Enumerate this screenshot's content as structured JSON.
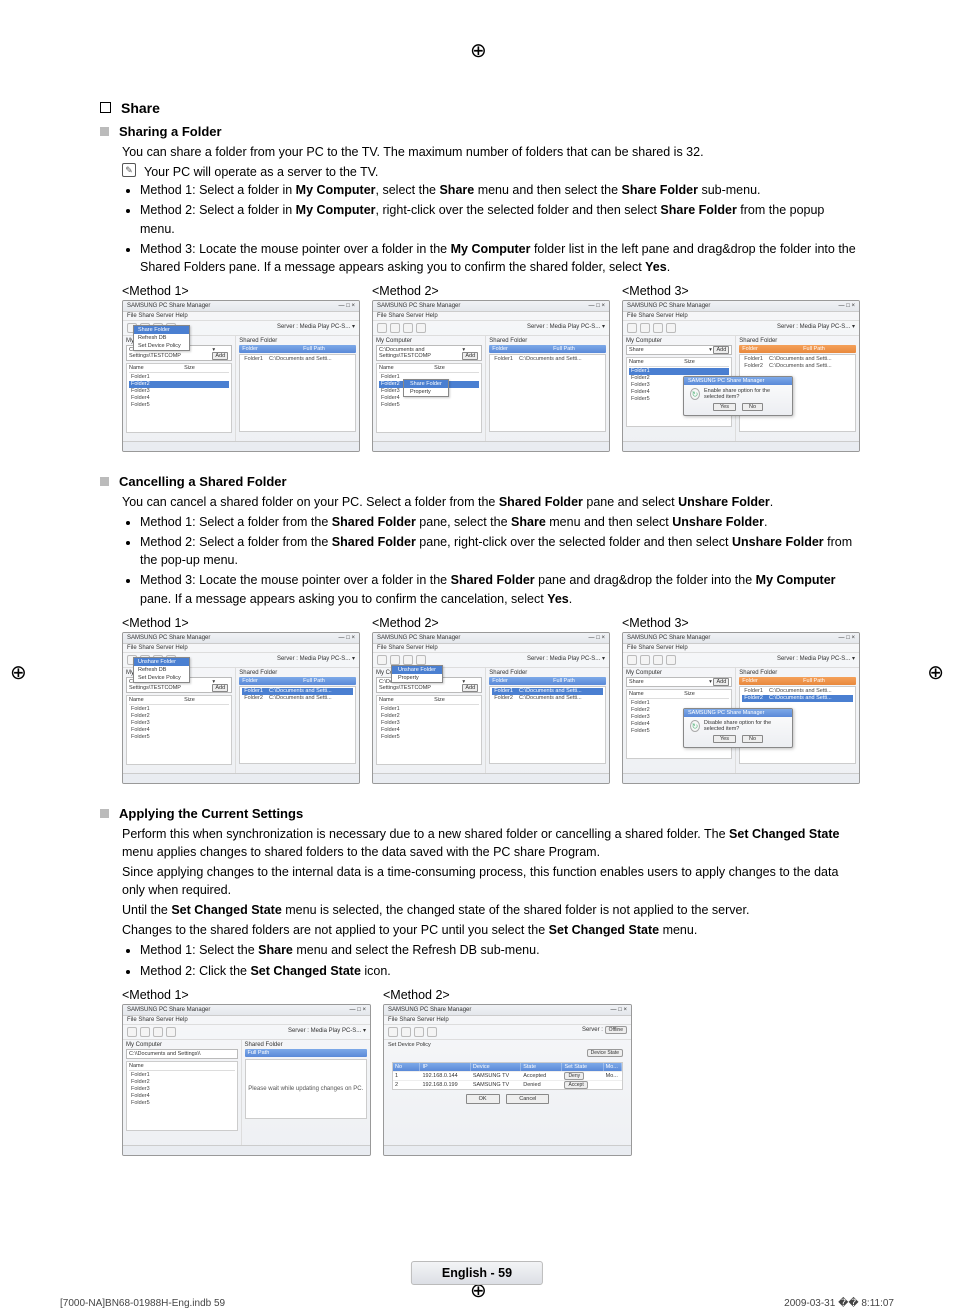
{
  "sectionTitle": "Share",
  "sharing": {
    "title": "Sharing a Folder",
    "intro": "You can share a folder from your PC to the TV. The maximum number of folders that can be shared is 32.",
    "note": "Your PC will operate as a server to the TV.",
    "m1_a": "Method 1: Select a folder in ",
    "m1_b": "My Computer",
    "m1_c": ", select the ",
    "m1_d": "Share",
    "m1_e": " menu and then select the ",
    "m1_f": "Share Folder",
    "m1_g": " sub-menu.",
    "m2_a": "Method 2: Select a folder in ",
    "m2_b": "My Computer",
    "m2_c": ", right-click over the selected folder and then select ",
    "m2_d": "Share Folder",
    "m2_e": " from the popup menu.",
    "m3_a": "Method 3: Locate the mouse pointer over a folder in the ",
    "m3_b": "My Computer",
    "m3_c": " folder list in the left pane and drag&drop the folder into the Shared Folders pane. If a message appears asking you to confirm the shared folder, select ",
    "m3_d": "Yes",
    "m3_e": ".",
    "label1": "<Method 1>",
    "label2": "<Method 2>",
    "label3": "<Method 3>"
  },
  "cancel": {
    "title": "Cancelling a Shared Folder",
    "intro_a": "You can cancel a shared folder on your PC. Select a folder from the ",
    "intro_b": "Shared Folder",
    "intro_c": " pane and select ",
    "intro_d": "Unshare Folder",
    "intro_e": ".",
    "m1_a": "Method 1: Select a folder from the ",
    "m1_b": "Shared Folder",
    "m1_c": " pane, select the ",
    "m1_d": "Share",
    "m1_e": " menu and then select ",
    "m1_f": "Unshare Folder",
    "m1_g": ".",
    "m2_a": "Method 2: Select a folder from the ",
    "m2_b": "Shared Folder",
    "m2_c": " pane, right-click over the selected folder and then select ",
    "m2_d": "Unshare Folder",
    "m2_e": " from the pop-up menu.",
    "m3_a": "Method 3: Locate the mouse pointer over a folder in the ",
    "m3_b": "Shared Folder",
    "m3_c": " pane and drag&drop the folder into the ",
    "m3_d": "My Computer",
    "m3_e": " pane. If a message appears asking you to confirm the cancelation, select ",
    "m3_f": "Yes",
    "m3_g": ".",
    "label1": "<Method 1>",
    "label2": "<Method 2>",
    "label3": "<Method 3>"
  },
  "apply": {
    "title": "Applying the Current Settings",
    "p1_a": "Perform this when synchronization is necessary due to a new shared folder or cancelling a shared folder. The ",
    "p1_b": "Set Changed State",
    "p1_c": " menu applies changes to shared folders to the data saved with the PC share Program.",
    "p2": "Since applying changes to the internal data is a time-consuming process, this function enables users to apply changes to the data only when required.",
    "p3_a": "Until the ",
    "p3_b": "Set Changed State",
    "p3_c": " menu is selected, the changed state of the shared folder is not applied to the server.",
    "p4_a": "Changes to the shared folders are not applied to your PC until you select the ",
    "p4_b": "Set Changed State",
    "p4_c": " menu.",
    "m1_a": "Method 1: Select the ",
    "m1_b": "Share",
    "m1_c": " menu and select the Refresh DB sub-menu.",
    "m2_a": "Method 2: Click the ",
    "m2_b": "Set Changed State",
    "m2_c": " icon.",
    "label1": "<Method 1>",
    "label2": "<Method 2>"
  },
  "mock": {
    "appTitle": "SAMSUNG PC Share Manager",
    "menu": "File    Share    Server    Help",
    "serverLabel": "Server :",
    "serverValue": "Media Play PC-S...",
    "leftPaneLabel": "My Computer",
    "rightPaneLabel": "Shared Folder",
    "colName": "Name",
    "colSize": "Size",
    "colFolder": "Folder",
    "colFullPath": "Full Path",
    "path1": "C:\\Documents and Settings\\TESTCOMP",
    "pathShare": "Share",
    "addBtn": "Add",
    "folders": [
      "Folder1",
      "Folder2",
      "Folder3",
      "Folder4",
      "Folder5"
    ],
    "sharedFolder": "Folder1",
    "sharedPath": "C:\\Documents and Setti...",
    "dropdown": {
      "item1": "Share Folder",
      "item2": "Refresh DB",
      "item3": "Set Device Policy"
    },
    "ctx": {
      "share": "Share Folder",
      "unshare": "Unshare Folder",
      "property": "Property"
    },
    "popup": {
      "title": "SAMSUNG PC Share Manager",
      "msgShare": "Enable share option for the selected item?",
      "msgUnshare": "Disable share option for the selected item?",
      "yes": "Yes",
      "no": "No"
    },
    "applyingMsg": "Please wait while updating changes on PC.",
    "policyTitle": "Set Device Policy",
    "policyDesc": "Device State",
    "devHead": {
      "no": "No",
      "ip": "IP",
      "device": "Device",
      "state": "State",
      "setState": "Set State",
      "model": "Mo..."
    },
    "devRows": [
      {
        "no": "1",
        "ip": "192.168.0.144",
        "device": "SAMSUNG TV",
        "state": "Accepted",
        "setState": "Deny",
        "model": "Mo..."
      },
      {
        "no": "2",
        "ip": "192.168.0.199",
        "device": "SAMSUNG TV",
        "state": "Denied",
        "setState": "Accept",
        "model": ""
      }
    ],
    "ok": "OK",
    "cancelBtn": "Cancel",
    "offline": "Offline"
  },
  "footer": "English - 59",
  "print": {
    "left": "[7000-NA]BN68-01988H-Eng.indb   59",
    "right": "2009-03-31   �� 8:11:07"
  }
}
